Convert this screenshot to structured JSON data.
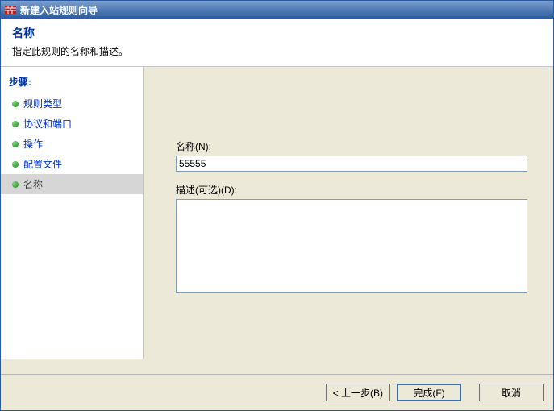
{
  "window": {
    "title": "新建入站规则向导"
  },
  "header": {
    "title": "名称",
    "subtitle": "指定此规则的名称和描述。"
  },
  "sidebar": {
    "steps_title": "步骤:",
    "items": [
      {
        "label": "规则类型"
      },
      {
        "label": "协议和端口"
      },
      {
        "label": "操作"
      },
      {
        "label": "配置文件"
      },
      {
        "label": "名称"
      }
    ]
  },
  "form": {
    "name_label": "名称(N):",
    "name_value": "55555",
    "desc_label": "描述(可选)(D):",
    "desc_value": ""
  },
  "buttons": {
    "back": "< 上一步(B)",
    "finish": "完成(F)",
    "cancel": "取消"
  }
}
